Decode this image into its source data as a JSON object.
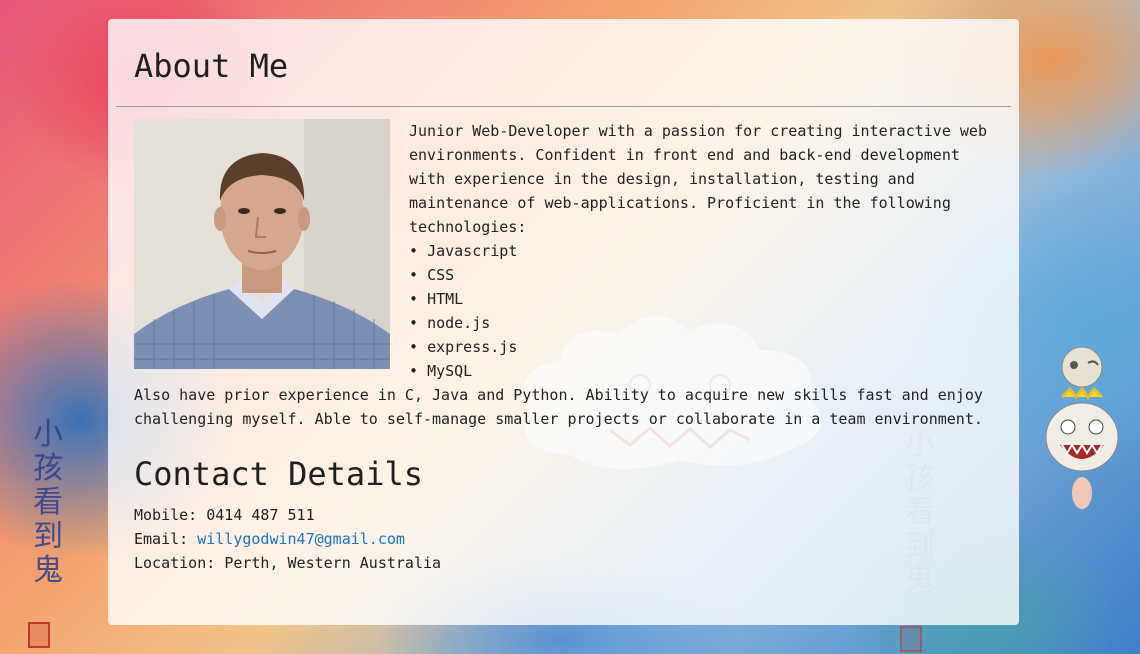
{
  "about": {
    "title": "About Me",
    "intro": "Junior Web-Developer with a passion for creating interactive web environments. Confident in front end and back-end development with experience in the design, installation, testing and maintenance of web-applications. Proficient in the following technologies:",
    "technologies": [
      "Javascript",
      "CSS",
      "HTML",
      "node.js",
      "express.js",
      "MySQL"
    ],
    "outro": "Also have prior experience in C, Java and Python. Ability to acquire new skills fast and enjoy challenging myself. Able to self-manage smaller projects or collaborate in a team environment."
  },
  "contact": {
    "title": "Contact Details",
    "mobile_label": "Mobile:",
    "mobile_value": "0414 487 511",
    "email_label": "Email:",
    "email_value": "willygodwin47@gmail.com",
    "location_label": "Location:",
    "location_value": "Perth, Western Australia"
  },
  "background": {
    "kanji": [
      "小",
      "孩",
      "看",
      "到",
      "鬼"
    ]
  },
  "icons": {
    "profile_photo": "profile-photo",
    "background_artwork": "background-artwork"
  }
}
